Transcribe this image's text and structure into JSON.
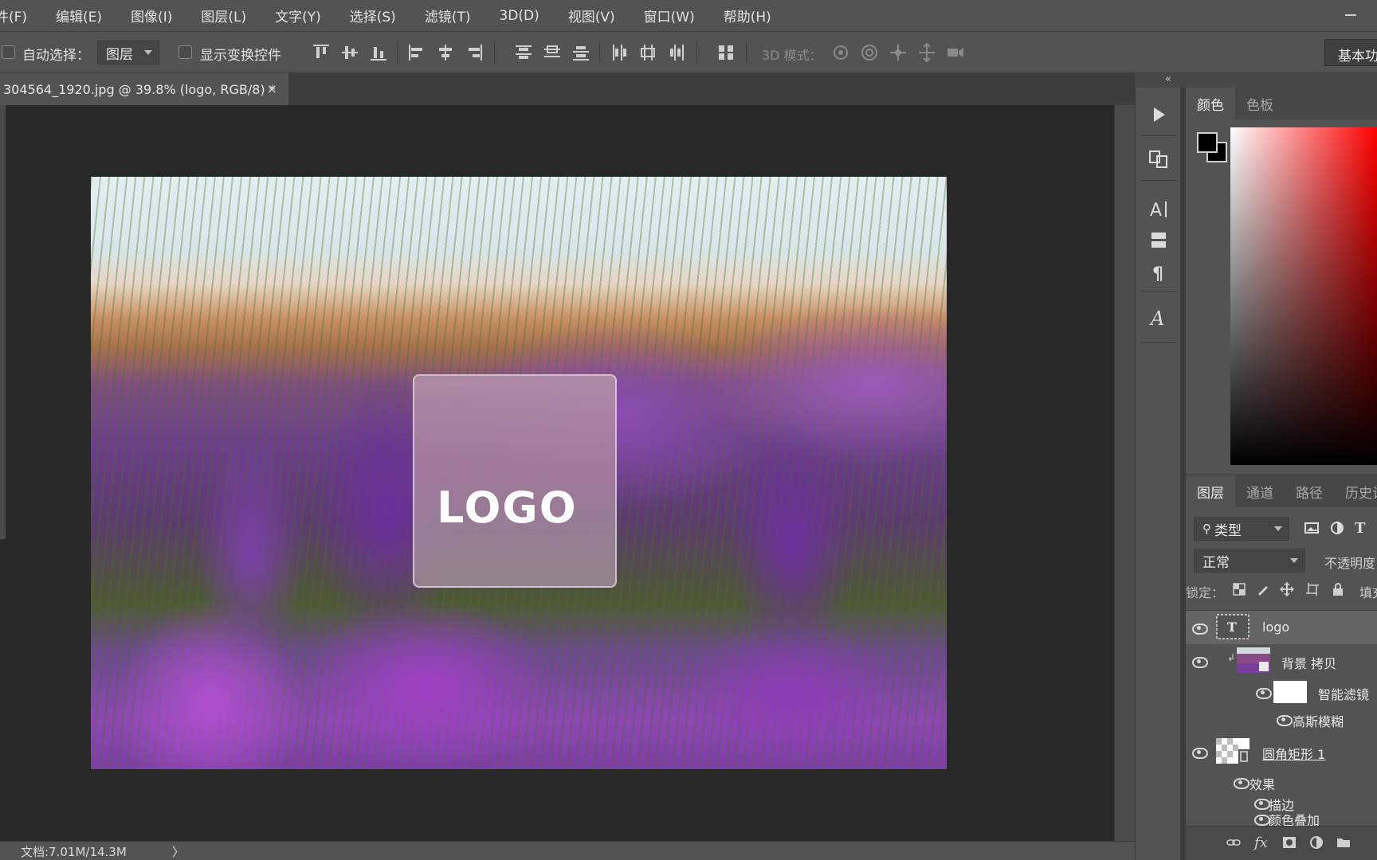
{
  "menu": [
    "件(F)",
    "编辑(E)",
    "图像(I)",
    "图层(L)",
    "文字(Y)",
    "选择(S)",
    "滤镜(T)",
    "3D(D)",
    "视图(V)",
    "窗口(W)",
    "帮助(H)"
  ],
  "options": {
    "auto_select_label": "自动选择：",
    "auto_select_value": "图层",
    "show_transform_label": "显示变换控件",
    "mode_3d_label": "3D 模式：",
    "workspace": "基本功"
  },
  "document": {
    "tab_title": "304564_1920.jpg @ 39.8% (logo, RGB/8) *",
    "close": "×",
    "logo_text": "LOGO"
  },
  "status": {
    "doc_size": "文档:7.01M/14.3M",
    "arrow": "〉"
  },
  "panels": {
    "collapse": "«",
    "color_tabs": [
      "颜色",
      "色板"
    ],
    "layers_tabs": [
      "图层",
      "通道",
      "路径",
      "历史记"
    ],
    "kind_filter": "类型",
    "blend_mode": "正常",
    "opacity_label": "不透明度",
    "lock_label": "锁定：",
    "fill_label": "填充"
  },
  "layers": {
    "logo": "logo",
    "bg_copy": "背景 拷贝",
    "smart_filters": "智能滤镜",
    "gaussian_blur": "高斯模糊",
    "rounded_rect": "圆角矩形 1",
    "effects": "效果",
    "stroke": "描边",
    "color_overlay": "颜色叠加"
  },
  "colors": {
    "ui_bg": "#535353",
    "canvas_bg": "#282828",
    "foreground": "#000000",
    "background": "#000000",
    "spectrum_hue": "#ff0000"
  }
}
